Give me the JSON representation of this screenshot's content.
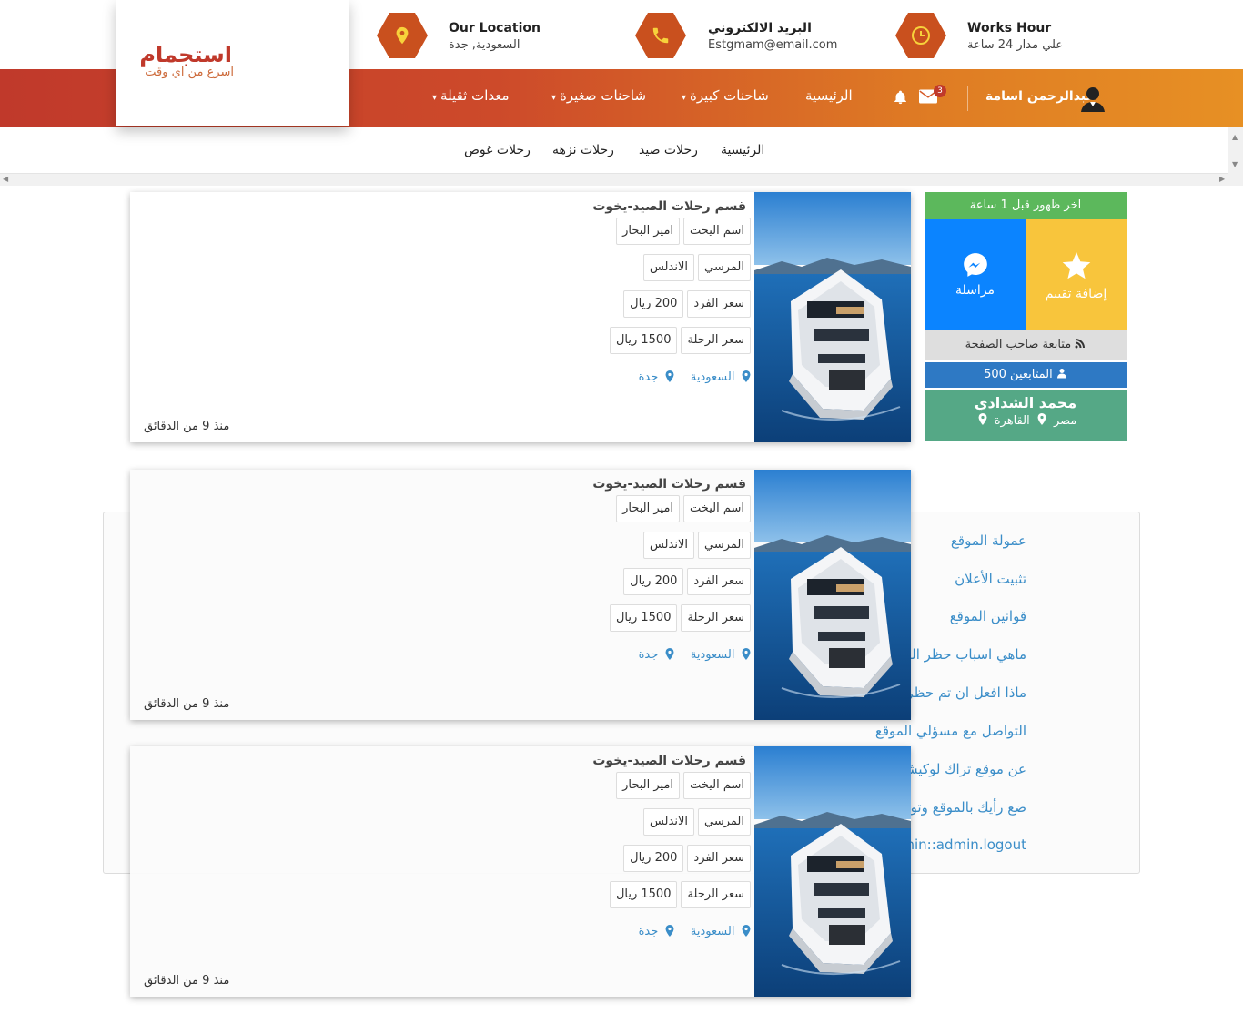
{
  "header": {
    "location": {
      "title": "Our Location",
      "value": "السعودية, جدة"
    },
    "email": {
      "title": "البريد الالكتروني",
      "value": "Estgmam@email.com"
    },
    "hours": {
      "title": "Works Hour",
      "value": "علي مدار 24 ساعة"
    }
  },
  "logo": {
    "name": "استجمام",
    "slogan": "اسرع من اي وقت"
  },
  "nav": {
    "user": "عبدالرحمن اسامة",
    "mail_count": "3",
    "items": [
      "الرئيسية",
      "شاحنات كبيرة",
      "شاحنات صغيرة",
      "معدات ثقيلة"
    ]
  },
  "submenu": {
    "items": [
      "الرئيسية",
      "رحلات صيد",
      "رحلات نزهه",
      "رحلات غوص"
    ]
  },
  "sidebar": {
    "last_seen": "اخر ظهور قبل 1 ساعة",
    "rate_label": "إضافة تقييم",
    "message_label": "مراسلة",
    "follow_label": "متابعة صاحب الصفحة",
    "followers": "المتابعين 500",
    "owner_name": "محمد الشدادي",
    "owner_country": "مصر",
    "owner_city": "القاهرة"
  },
  "help_links": [
    "عمولة الموقع",
    "تثبيت الأعلان",
    "قوانين الموقع",
    "ماهي اسباب حظر العضوية ؟",
    "ماذا افعل ان تم حظري ؟",
    "التواصل مع مسؤلي الموقع",
    "عن موقع تراك لوكيشن",
    "ضع رأيك بالموقع وتوصيتك في تحسينة",
    "admin::admin.logout"
  ],
  "listings": [
    {
      "title": "قسم رحلات الصيد-يخوت",
      "rows": [
        [
          "اسم اليخت",
          "امير البحار"
        ],
        [
          "المرسي",
          "الاندلس"
        ],
        [
          "سعر الفرد",
          "200 ريال"
        ],
        [
          "سعر الرحلة",
          "1500 ريال"
        ]
      ],
      "country": "السعودية",
      "city": "جدة",
      "time": "منذ 9 من الدقائق"
    },
    {
      "title": "قسم رحلات الصيد-يخوت",
      "rows": [
        [
          "اسم اليخت",
          "امير البحار"
        ],
        [
          "المرسي",
          "الاندلس"
        ],
        [
          "سعر الفرد",
          "200 ريال"
        ],
        [
          "سعر الرحلة",
          "1500 ريال"
        ]
      ],
      "country": "السعودية",
      "city": "جدة",
      "time": "منذ 9 من الدقائق"
    },
    {
      "title": "قسم رحلات الصيد-يخوت",
      "rows": [
        [
          "اسم اليخت",
          "امير البحار"
        ],
        [
          "المرسي",
          "الاندلس"
        ],
        [
          "سعر الفرد",
          "200 ريال"
        ],
        [
          "سعر الرحلة",
          "1500 ريال"
        ]
      ],
      "country": "السعودية",
      "city": "جدة",
      "time": "منذ 9 من الدقائق"
    }
  ],
  "colors": {
    "brand_red": "#c0392b",
    "brand_orange": "#e79024",
    "hex_icon": "#c9501e",
    "link_blue": "#3a8dc8"
  },
  "icons": [
    "clock-icon",
    "phone-icon",
    "map-pin-icon",
    "user-avatar-icon",
    "envelope-icon",
    "bell-icon",
    "star-icon",
    "messenger-icon",
    "rss-icon",
    "user-icon",
    "location-pin-icon"
  ]
}
